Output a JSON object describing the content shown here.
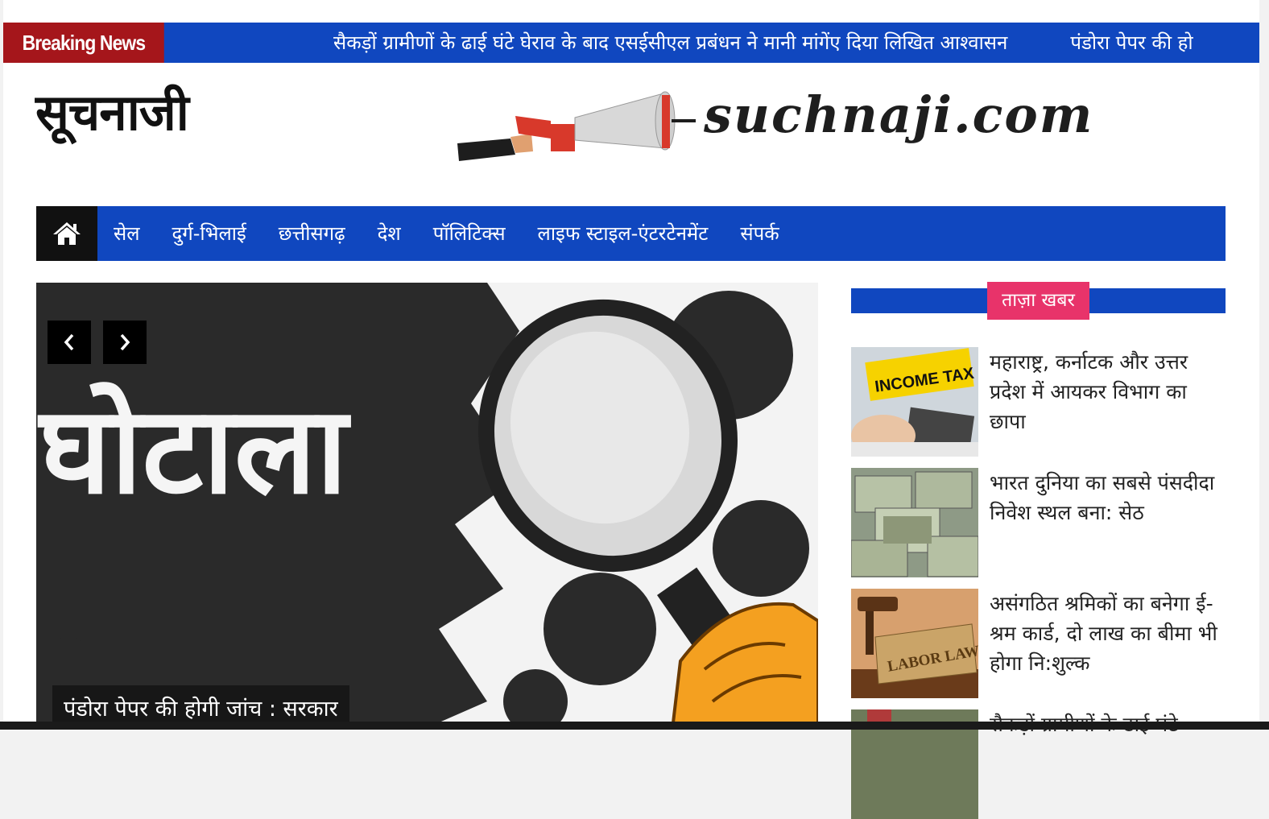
{
  "ticker": {
    "label": "Breaking News",
    "items": [
      "सैकड़ों ग्रामीणों के ढाई घंटे घेराव के बाद एसईसीएल प्रबंधन ने मानी मांगेंए दिया लिखित आश्वासन",
      "पंडोरा पेपर की होगी जांच : सरकार"
    ]
  },
  "header": {
    "site_title": "सूचनाजी",
    "logo_text": "suchnaji.com"
  },
  "nav": {
    "home_icon": "home-icon",
    "items": [
      "सेल",
      "दुर्ग-भिलाई",
      "छत्तीसगढ़",
      "देश",
      "पॉलिटिक्स",
      "लाइफ स्टाइल-एंटरटेनमेंट",
      "संपर्क"
    ]
  },
  "slider": {
    "image_word": "घोटाला",
    "caption": "पंडोरा पेपर की होगी जांच : सरकार",
    "prev_icon": "chevron-left-icon",
    "next_icon": "chevron-right-icon"
  },
  "sidebar": {
    "heading": "ताज़ा खबर",
    "items": [
      {
        "title": "महाराष्ट्र, कर्नाटक और उत्तर प्रदेश में आयकर विभाग का छापा",
        "thumb_text": "INCOME TAX"
      },
      {
        "title": "भारत दुनिया का सबसे पंसदीदा निवेश स्थल बना: सेठ",
        "thumb_text": ""
      },
      {
        "title": "असंगठित श्रमिकों का बनेगा ई-श्रम कार्ड, दो लाख का बीमा भी होगा नि:शुल्क",
        "thumb_text": "LABOR LAW"
      },
      {
        "title": "सैकड़ों ग्रामीणों के ढाई घंटे",
        "thumb_text": ""
      }
    ]
  },
  "colors": {
    "nav_blue": "#1047bf",
    "breaking_red": "#a5161b",
    "heading_pink": "#e8336a"
  }
}
